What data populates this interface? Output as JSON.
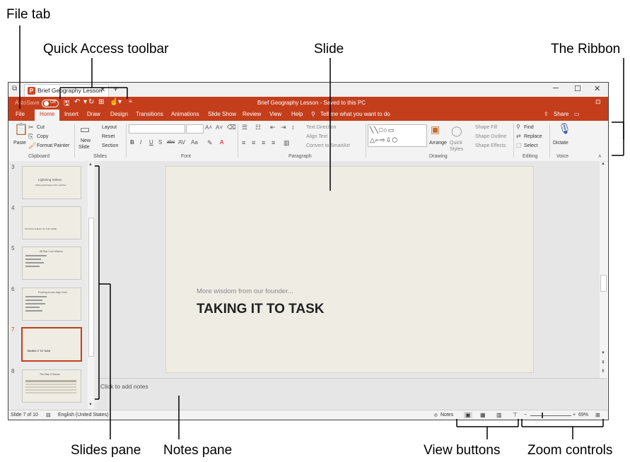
{
  "callouts": {
    "file_tab": "File tab",
    "quick_access": "Quick Access toolbar",
    "slide": "Slide",
    "ribbon": "The Ribbon",
    "slides_pane": "Slides pane",
    "notes_pane": "Notes pane",
    "view_buttons": "View buttons",
    "zoom_controls": "Zoom controls"
  },
  "window": {
    "tab_title": "Brief Geography Lesson",
    "autosave_label": "AutoSave",
    "autosave_state": "Off",
    "doc_title": "Brief Geography Lesson - Saved to this PC",
    "minimize": "─",
    "maximize": "☐",
    "close": "✕"
  },
  "ribbon_tabs": [
    "File",
    "Home",
    "Insert",
    "Draw",
    "Design",
    "Transitions",
    "Animations",
    "Slide Show",
    "Review",
    "View",
    "Help"
  ],
  "tell_me": "Tell me what you want to do",
  "share": "Share",
  "ribbon": {
    "clipboard": {
      "paste": "Paste",
      "cut": "Cut",
      "copy": "Copy",
      "format_painter": "Format Painter",
      "group": "Clipboard"
    },
    "slides": {
      "new_slide": "New",
      "new_slide2": "Slide",
      "layout": "Layout",
      "reset": "Reset",
      "section": "Section",
      "group": "Slides"
    },
    "font": {
      "group": "Font"
    },
    "paragraph": {
      "text_direction": "Text Direction",
      "align_text": "Align Text",
      "smartart": "Convert to SmartArt",
      "group": "Paragraph"
    },
    "drawing": {
      "arrange": "Arrange",
      "quick_styles": "Quick",
      "quick_styles2": "Styles",
      "shape_fill": "Shape Fill",
      "shape_outline": "Shape Outline",
      "shape_effects": "Shape Effects",
      "group": "Drawing"
    },
    "editing": {
      "find": "Find",
      "replace": "Replace",
      "select": "Select",
      "group": "Editing"
    },
    "voice": {
      "dictate": "Dictate",
      "group": "Voice"
    }
  },
  "thumbnails": [
    {
      "num": "3",
      "line1": "Lightning Strikes",
      "line2": "Taking advantage of the weather"
    },
    {
      "num": "4",
      "line1": "",
      "line2": "STAYING AHEAD OF THE GAME"
    },
    {
      "num": "5",
      "line1": "All-Star Core Mission",
      "line2": ""
    },
    {
      "num": "6",
      "line1": "Pushing to new High Goal",
      "line2": ""
    },
    {
      "num": "7",
      "line1": "",
      "line2": "TAKING IT TO TASK"
    },
    {
      "num": "8",
      "line1": "The Way It Stands",
      "line2": ""
    }
  ],
  "slide": {
    "subtitle": "More wisdom from our founder...",
    "title": "TAKING IT TO TASK"
  },
  "notes_placeholder": "Click to add notes",
  "status": {
    "slide_count": "Slide 7 of 10",
    "language": "English (United States)",
    "notes": "Notes",
    "zoom": "69%"
  }
}
